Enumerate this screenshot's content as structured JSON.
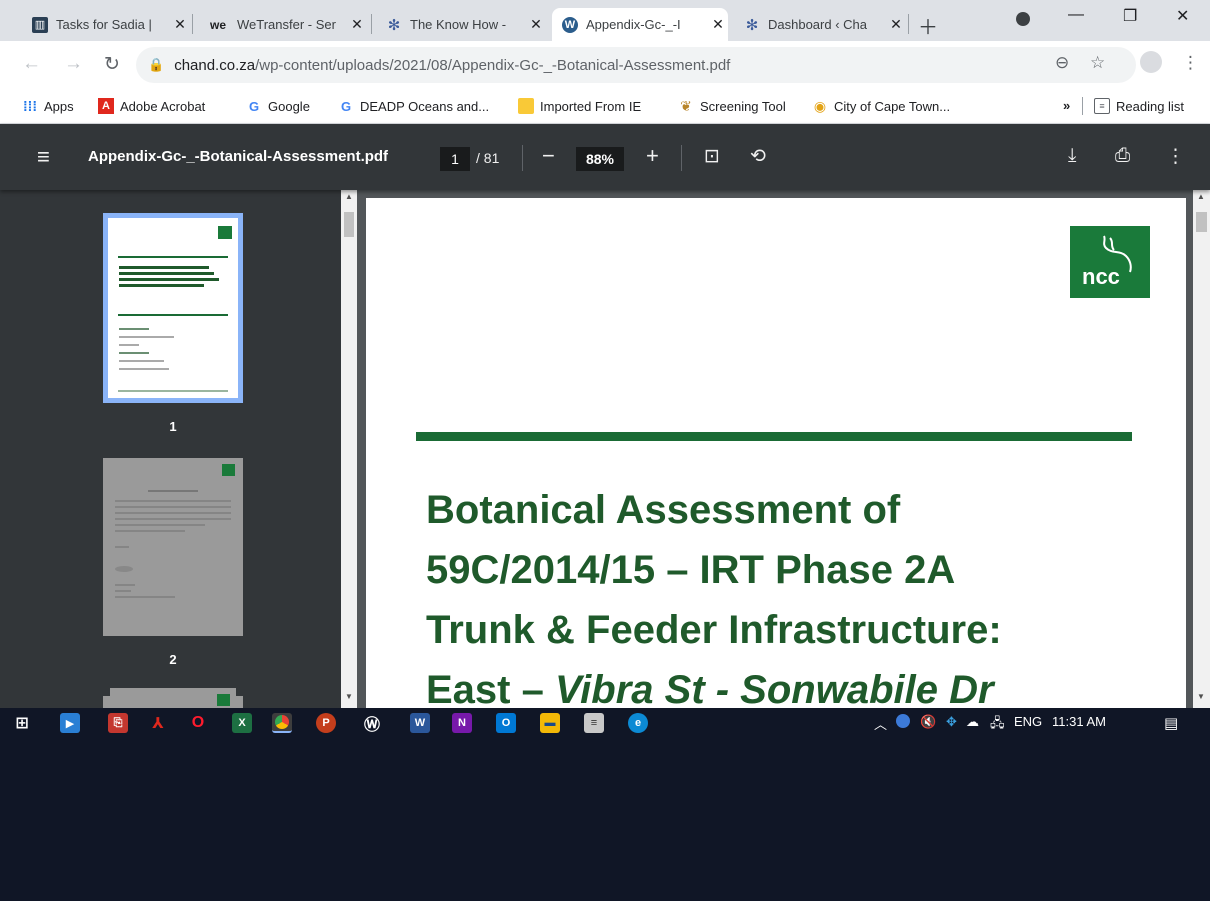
{
  "browser": {
    "tabs": [
      {
        "title": "Tasks for Sadia |",
        "icon": "trello-icon"
      },
      {
        "title": "WeTransfer - Ser",
        "icon": "wetransfer-icon"
      },
      {
        "title": "The Know How -",
        "icon": "knowhow-icon"
      },
      {
        "title": "Appendix-Gc-_-I",
        "icon": "wordpress-icon",
        "active": true
      },
      {
        "title": "Dashboard ‹ Cha",
        "icon": "knowhow-icon"
      }
    ],
    "url_host": "chand.co.za",
    "url_path": "/wp-content/uploads/2021/08/Appendix-Gc-_-Botanical-Assessment.pdf",
    "bookmarks": [
      {
        "label": "Apps",
        "icon": "apps-grid-icon"
      },
      {
        "label": "Adobe Acrobat",
        "icon": "adobe-icon"
      },
      {
        "label": "Google",
        "icon": "google-icon"
      },
      {
        "label": "DEADP Oceans and...",
        "icon": "google-icon"
      },
      {
        "label": "Imported From IE",
        "icon": "folder-icon"
      },
      {
        "label": "Screening Tool",
        "icon": "coat-of-arms-icon"
      },
      {
        "label": "City of Cape Town...",
        "icon": "cape-town-icon"
      }
    ],
    "reading_list": "Reading list",
    "more_bookmarks": "»"
  },
  "pdf": {
    "filename": "Appendix-Gc-_-Botanical-Assessment.pdf",
    "page_current": "1",
    "page_total": "/ 81",
    "zoom": "88%",
    "thumbnails": [
      {
        "label": "1"
      },
      {
        "label": "2"
      }
    ],
    "logo_text": "ncc",
    "title_lines": [
      "Botanical Assessment of",
      "59C/2014/15 – IRT Phase 2A",
      "Trunk & Feeder Infrastructure:"
    ],
    "title_line4_prefix": "East – ",
    "title_line4_italic": "Vibra St - Sonwabile Dr"
  },
  "taskbar": {
    "tray_lang": "ENG",
    "clock": "11:31 AM"
  },
  "colors": {
    "tabstrip": "#dee1e6",
    "pdf_toolbar": "#323639",
    "pdf_bg": "#525659",
    "ncc_green": "#1a7a3a",
    "title_green": "#1f5a2b",
    "taskbar": "#101626"
  }
}
